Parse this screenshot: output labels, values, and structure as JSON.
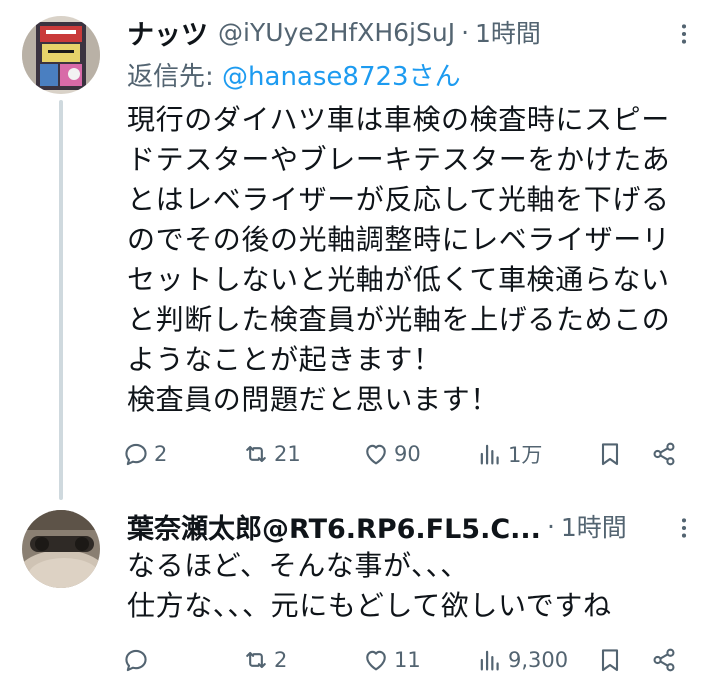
{
  "tweets": [
    {
      "display_name": "ナッツ",
      "handle": "@iYUye2HfXH6jSuJ",
      "separator": "·",
      "time": "1時間",
      "reply_to_prefix": "返信先: ",
      "reply_to_mention": "@hanase8723",
      "reply_to_suffix": "さん",
      "text": "現行のダイハツ車は車検の検査時にスピー\nドテスターやブレーキテスターをかけたあ\nとはレベライザーが反応して光軸を下げる\nのでその後の光軸調整時にレベライザーリ\nセットしないと光軸が低くて車検通らない\nと判断した検査員が光軸を上げるためこの\nようなことが起きます！\n検査員の問題だと思います！",
      "replies": "2",
      "retweets": "21",
      "likes": "90",
      "views": "1万",
      "avatar_icon": "avatar-collage-image"
    },
    {
      "display_name": "葉奈瀬太郎@RT6.RP6.FL5.C...",
      "separator": "·",
      "time": "1時間",
      "text": "なるほど、そんな事が、、、\n仕方な、、、元にもどして欲しいですね",
      "replies": "",
      "retweets": "2",
      "likes": "11",
      "views": "9,300",
      "avatar_icon": "avatar-photo-image"
    }
  ],
  "colors": {
    "text": "#0f1419",
    "secondary": "#536471",
    "link": "#1d9bf0",
    "thread_line": "#cfd9de"
  },
  "icons": [
    "reply-icon",
    "retweet-icon",
    "like-icon",
    "views-icon",
    "bookmark-icon",
    "share-icon",
    "more-icon"
  ]
}
